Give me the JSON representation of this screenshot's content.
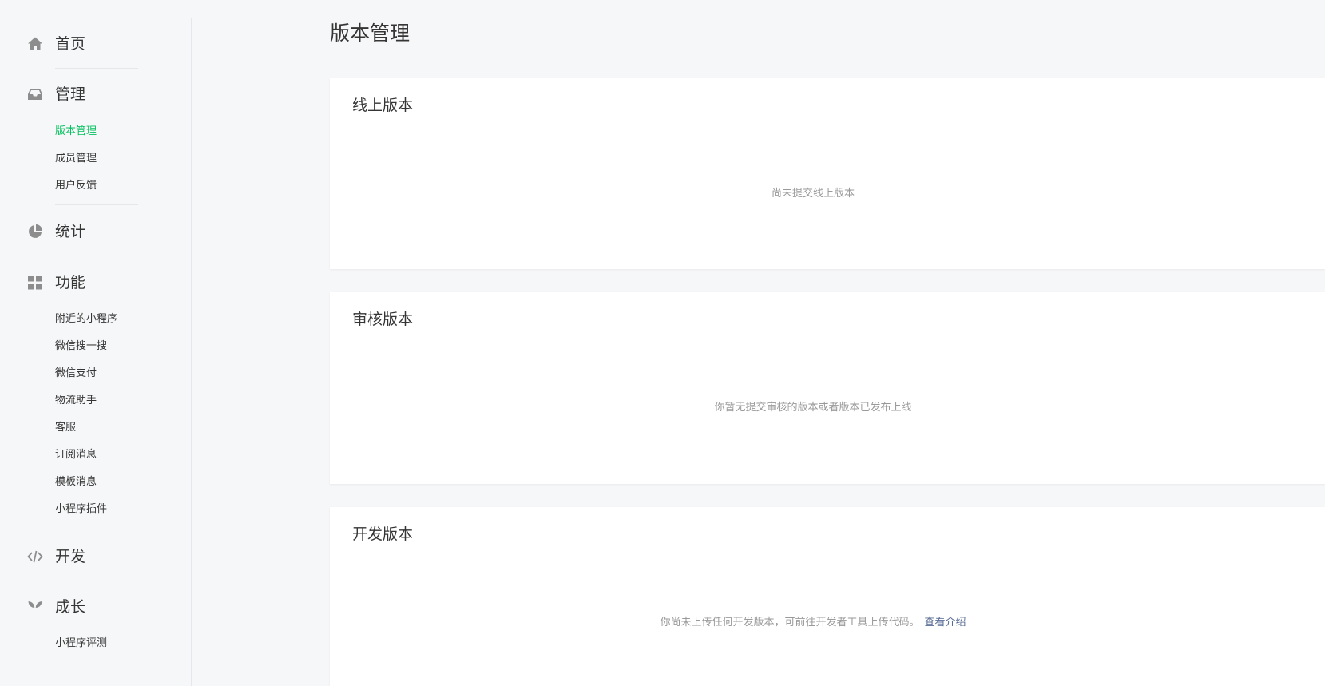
{
  "sidebar": {
    "home": {
      "label": "首页",
      "icon": "home-icon"
    },
    "manage": {
      "label": "管理",
      "icon": "inbox-icon",
      "items": [
        {
          "label": "版本管理",
          "active": true
        },
        {
          "label": "成员管理",
          "active": false
        },
        {
          "label": "用户反馈",
          "active": false
        }
      ]
    },
    "stats": {
      "label": "统计",
      "icon": "pie-chart-icon"
    },
    "features": {
      "label": "功能",
      "icon": "grid-icon",
      "items": [
        {
          "label": "附近的小程序"
        },
        {
          "label": "微信搜一搜"
        },
        {
          "label": "微信支付"
        },
        {
          "label": "物流助手"
        },
        {
          "label": "客服"
        },
        {
          "label": "订阅消息"
        },
        {
          "label": "模板消息"
        },
        {
          "label": "小程序插件"
        }
      ]
    },
    "develop": {
      "label": "开发",
      "icon": "code-icon"
    },
    "growth": {
      "label": "成长",
      "icon": "sprout-icon",
      "items": [
        {
          "label": "小程序评测"
        }
      ]
    }
  },
  "main": {
    "title": "版本管理",
    "panels": {
      "online": {
        "title": "线上版本",
        "empty": "尚未提交线上版本"
      },
      "review": {
        "title": "审核版本",
        "empty": "你暂无提交审核的版本或者版本已发布上线"
      },
      "dev": {
        "title": "开发版本",
        "empty": "你尚未上传任何开发版本，可前往开发者工具上传代码。",
        "link": "查看介绍"
      }
    }
  },
  "colors": {
    "accent": "#07c160",
    "link": "#576b95",
    "muted": "#9a9a9a",
    "icon": "#8d8d8d"
  }
}
